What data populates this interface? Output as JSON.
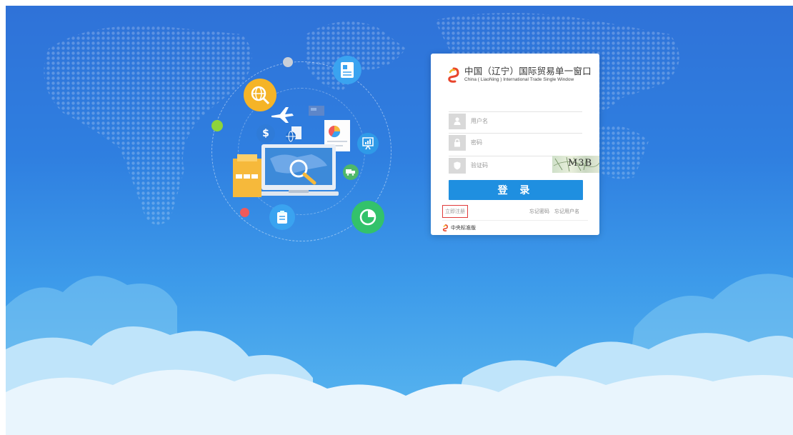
{
  "brand": {
    "title_cn": "中国（辽宁）国际贸易单一窗口",
    "title_en": "China ( LiaoNing ) International Trade Single  Window"
  },
  "form": {
    "username_placeholder": "用户名",
    "password_placeholder": "密码",
    "captcha_placeholder": "验证码",
    "captcha_text": "M3B",
    "login_label": "登 录"
  },
  "links": {
    "register": "立即注册",
    "forgot_password": "忘记密码",
    "forgot_username": "忘记用户名"
  },
  "footer": {
    "version": "中央标准版"
  },
  "colors": {
    "sky_top": "#2f72d8",
    "sky_bottom": "#5bb8f0",
    "login_button": "#1f8fe0",
    "register_highlight": "#e03b3b"
  },
  "icons": [
    "user-icon",
    "lock-icon",
    "shield-icon",
    "airplane-icon",
    "dollar-icon",
    "chart-icon",
    "document-icon",
    "magnifier-icon",
    "truck-icon",
    "globe-search-icon"
  ]
}
